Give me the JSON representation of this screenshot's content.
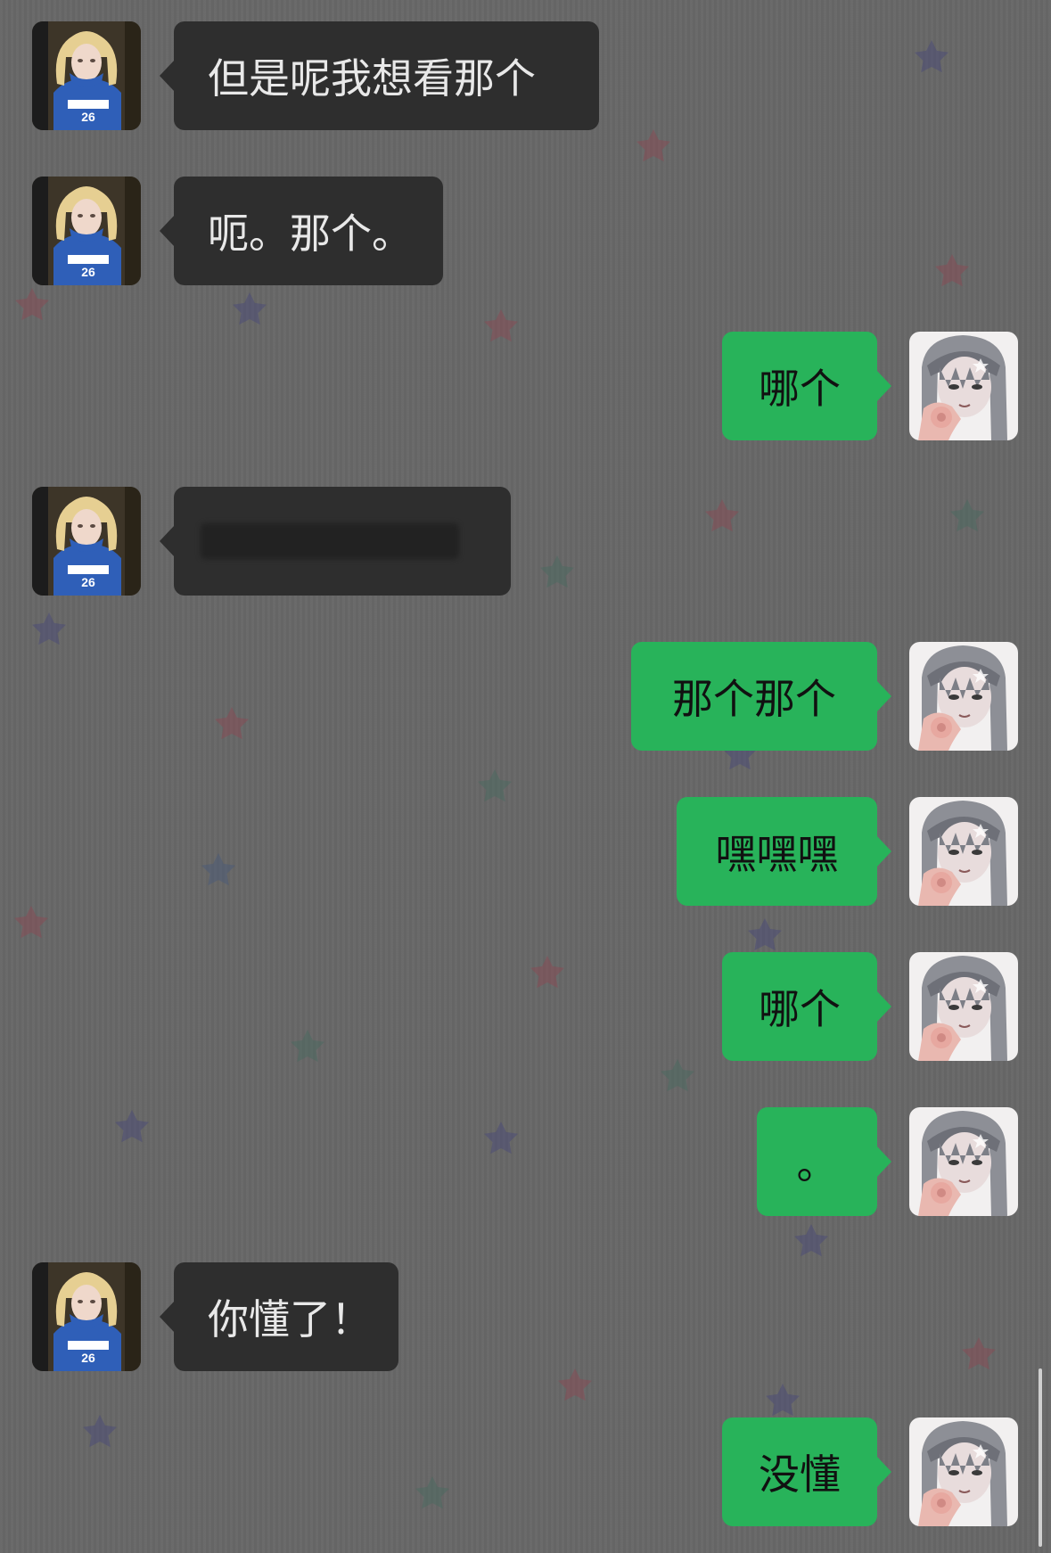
{
  "messages": [
    {
      "side": "left",
      "text": "但是呢我想看那个"
    },
    {
      "side": "left",
      "text": "呃。那个。"
    },
    {
      "side": "right",
      "text": "哪个"
    },
    {
      "side": "left",
      "text": "",
      "redacted": true
    },
    {
      "side": "right",
      "text": "那个那个"
    },
    {
      "side": "right",
      "text": "嘿嘿嘿"
    },
    {
      "side": "right",
      "text": "哪个"
    },
    {
      "side": "right",
      "text": "。"
    },
    {
      "side": "left",
      "text": "你懂了！"
    },
    {
      "side": "right",
      "text": "没懂"
    }
  ],
  "colors": {
    "background": "#676767",
    "left_bubble": "#2e2e2e",
    "right_bubble": "#28b35a"
  }
}
